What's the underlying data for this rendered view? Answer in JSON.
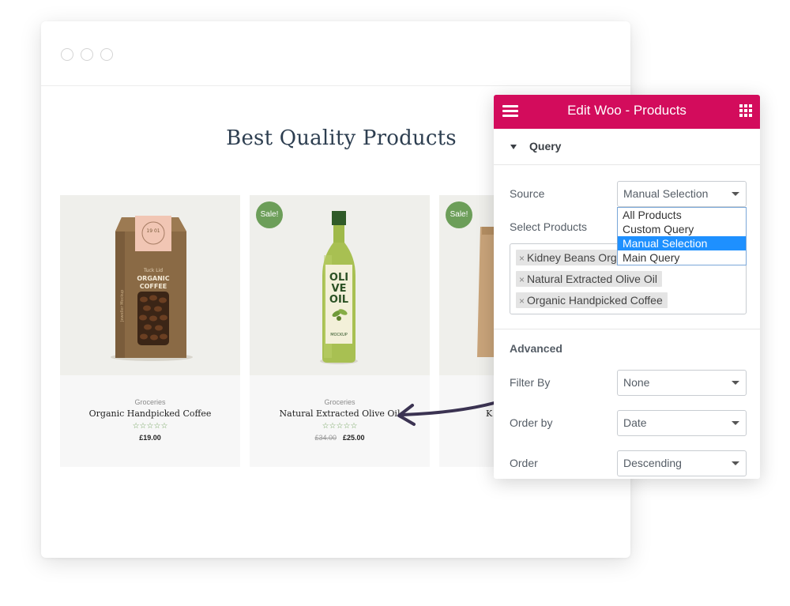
{
  "page": {
    "title": "Best Quality Products",
    "products": [
      {
        "category": "Groceries",
        "name": "Organic Handpicked Coffee",
        "stars": "☆☆☆☆☆",
        "price": "£19.00",
        "old_price": "",
        "sale": ""
      },
      {
        "category": "Groceries",
        "name": "Natural Extracted Olive Oil",
        "stars": "☆☆☆☆☆",
        "price": "£25.00",
        "old_price": "£34.00",
        "sale": "Sale!"
      },
      {
        "category": "",
        "name": "K",
        "stars": "",
        "price": "",
        "old_price": "",
        "sale": "Sale!"
      }
    ],
    "coffee_pack": {
      "brand": "Tuck Lid",
      "line1": "ORGANIC",
      "line2": "COFFEE",
      "badge": "19 01",
      "side": "Jeweller Mockup"
    },
    "olive_bottle": {
      "line1": "OLI",
      "line2": "VE",
      "line3": "OIL",
      "sub": "MOCKUP"
    }
  },
  "panel": {
    "title": "Edit Woo - Products",
    "section": "Query",
    "source_label": "Source",
    "source_value": "Manual Selection",
    "source_options": [
      "All Products",
      "Custom Query",
      "Manual Selection",
      "Main Query"
    ],
    "select_products_label": "Select Products",
    "selected_products": [
      "Kidney Beans Organic",
      "Natural Extracted Olive Oil",
      "Organic Handpicked Coffee"
    ],
    "advanced_label": "Advanced",
    "filter_by_label": "Filter By",
    "filter_by_value": "None",
    "order_by_label": "Order by",
    "order_by_value": "Date",
    "order_label": "Order",
    "order_value": "Descending"
  },
  "colors": {
    "accent": "#d30c5c",
    "sale": "#6c9e59",
    "title": "#2d3e50",
    "selected_option": "#1e90ff"
  },
  "icons": [
    "hamburger-icon",
    "apps-grid-icon",
    "caret-down-icon",
    "remove-tag-icon"
  ]
}
